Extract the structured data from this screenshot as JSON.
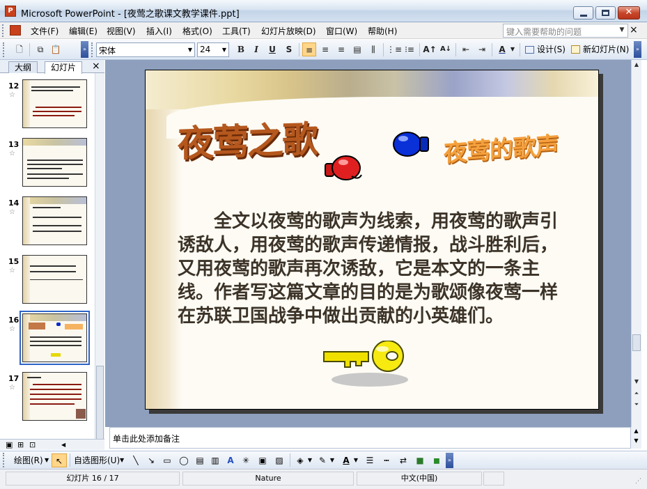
{
  "window": {
    "title": "Microsoft PowerPoint - [夜莺之歌课文教学课件.ppt]",
    "app_icon_label": "P",
    "close_glyph": "✕",
    "minimize_glyph": "—",
    "maximize_glyph": "□"
  },
  "menu": {
    "items": [
      "文件(F)",
      "编辑(E)",
      "视图(V)",
      "插入(I)",
      "格式(O)",
      "工具(T)",
      "幻灯片放映(D)",
      "窗口(W)",
      "帮助(H)"
    ],
    "help_placeholder": "键入需要帮助的问题",
    "doc_close": "×"
  },
  "toolbar": {
    "font_name": "宋体",
    "font_size": "24",
    "bold": "B",
    "italic": "I",
    "underline": "U",
    "shadow": "S",
    "design_label": "设计(S)",
    "new_slide_label": "新幻灯片(N)"
  },
  "left_panel": {
    "tabs": [
      "大纲",
      "幻灯片"
    ],
    "selected_tab": "幻灯片",
    "close": "×",
    "slides": [
      {
        "num": "12",
        "star": "☆"
      },
      {
        "num": "13",
        "star": "☆"
      },
      {
        "num": "14",
        "star": "☆"
      },
      {
        "num": "15",
        "star": "☆"
      },
      {
        "num": "16",
        "star": "☆"
      },
      {
        "num": "17",
        "star": "☆"
      }
    ],
    "selected_slide": "16"
  },
  "slide": {
    "title": "夜莺之歌",
    "subtitle": "夜莺的歌声",
    "body": "全文以夜莺的歌声为线索，用夜莺的歌声引诱敌人，用夜莺的歌声传递情报，战斗胜利后，又用夜莺的歌声再次诱敌，它是本文的一条主线。作者写这篇文章的目的是为歌颂像夜莺一样在苏联卫国战争中做出贡献的小英雄们。"
  },
  "notes": {
    "placeholder": "单击此处添加备注"
  },
  "drawing_toolbar": {
    "draw_label": "绘图(R)",
    "autoshapes_label": "自选图形(U)"
  },
  "status": {
    "slide_position": "幻灯片 16 / 17",
    "design_name": "Nature",
    "language": "中文(中国)"
  },
  "colors": {
    "title_brown": "#b5581e",
    "subtitle_orange": "#f4a03c",
    "body_text": "#3c3328",
    "slide_area_bg": "#8d9fbc"
  }
}
